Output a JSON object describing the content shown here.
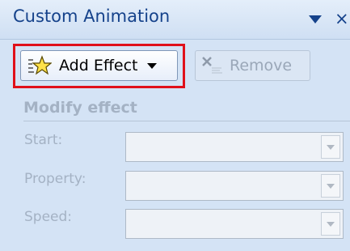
{
  "pane": {
    "title": "Custom Animation",
    "menu_icon": "triangle-down-icon",
    "close_glyph": "×"
  },
  "toolbar": {
    "add_effect_label": "Add Effect",
    "add_effect_icon": "star-sparkle-icon",
    "remove_label": "Remove",
    "remove_icon": "remove-x-icon"
  },
  "modify_effect": {
    "section_title": "Modify effect",
    "fields": [
      {
        "label": "Start:",
        "value": ""
      },
      {
        "label": "Property:",
        "value": ""
      },
      {
        "label": "Speed:",
        "value": ""
      }
    ]
  },
  "colors": {
    "highlight": "#e0101a",
    "title_text": "#15428b",
    "disabled_text": "#a4b2c4"
  }
}
